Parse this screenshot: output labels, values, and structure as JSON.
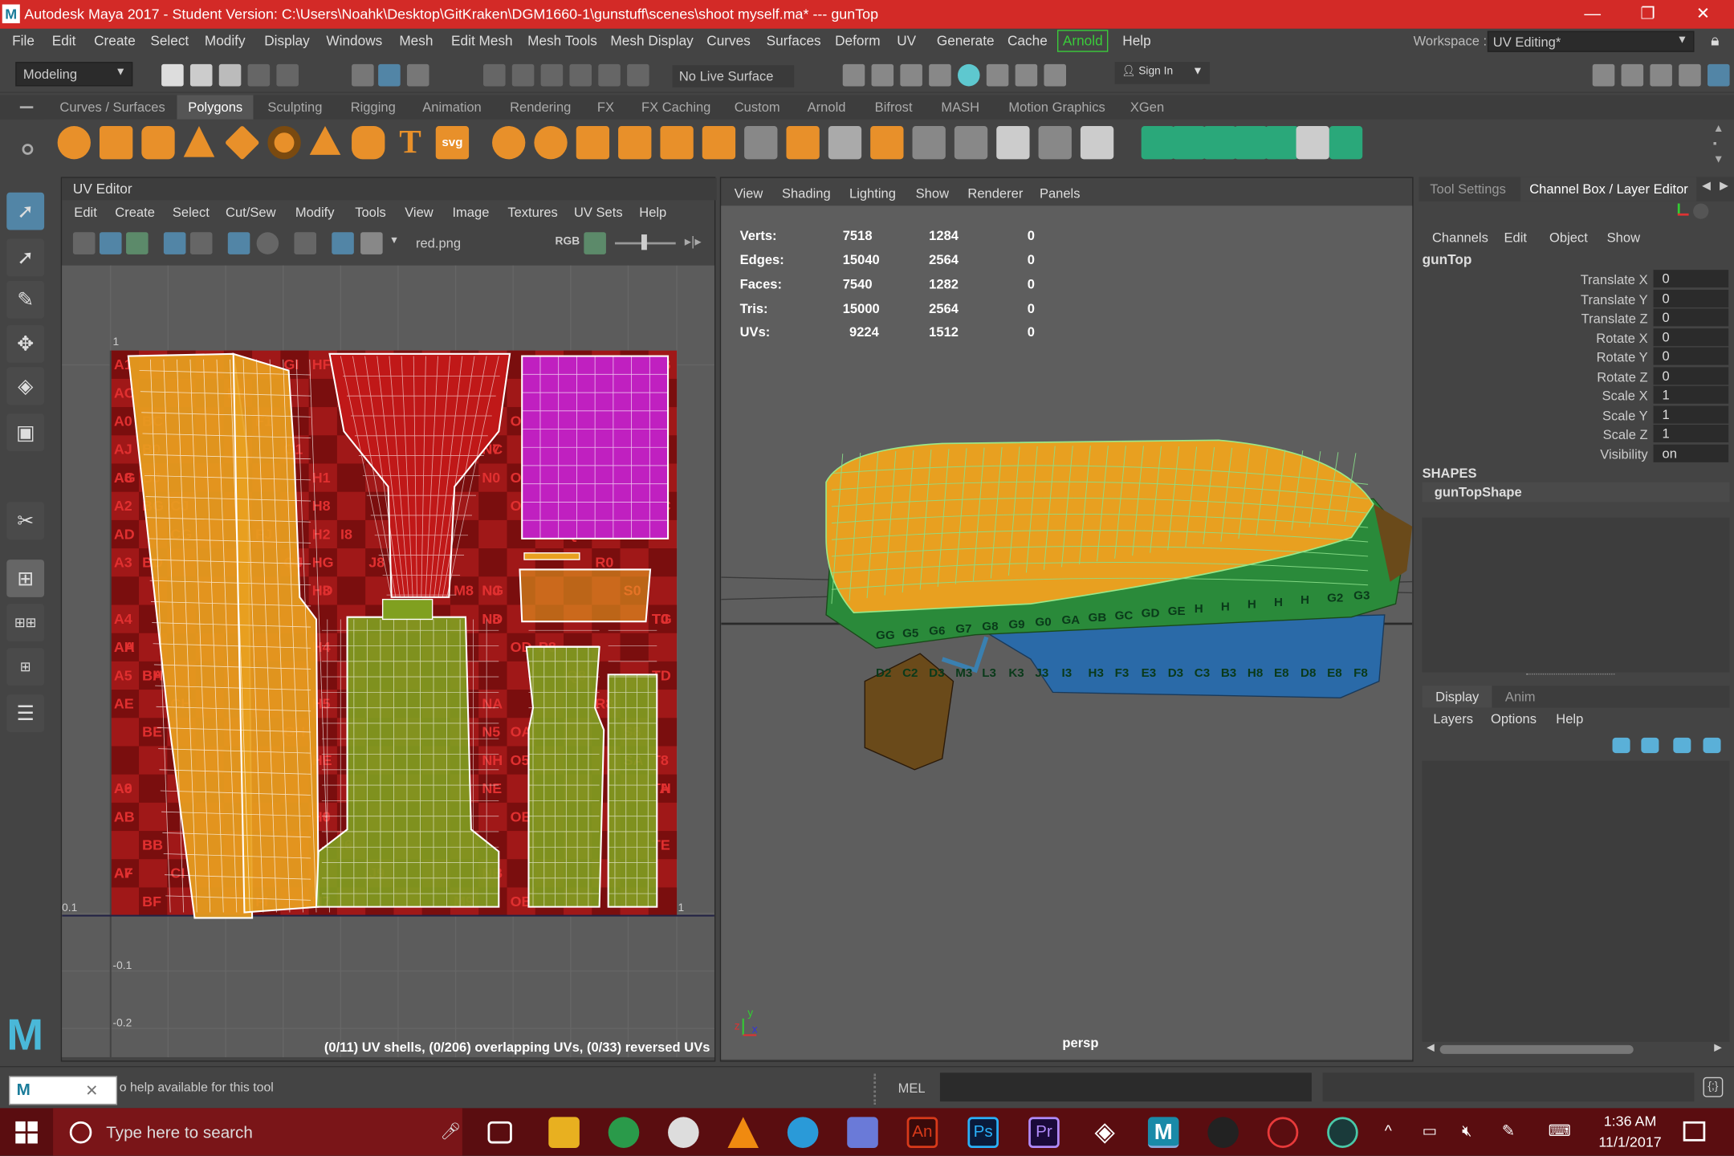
{
  "window": {
    "logo": "M",
    "title": "Autodesk Maya 2017 - Student Version: C:\\Users\\Noahk\\Desktop\\GitKraken\\DGM1660-1\\gunstuff\\scenes\\shoot myself.ma*   ---   gunTop",
    "minimize_icon": "—",
    "restore_icon": "❐",
    "close_icon": "✕"
  },
  "menubar": {
    "items": [
      "File",
      "Edit",
      "Create",
      "Select",
      "Modify",
      "Display",
      "Windows",
      "Mesh",
      "Edit Mesh",
      "Mesh Tools",
      "Mesh Display",
      "Curves",
      "Surfaces",
      "Deform",
      "UV",
      "Generate",
      "Cache",
      "Arnold",
      "Help"
    ],
    "workspace_label": "Workspace :",
    "workspace_value": "UV Editing*"
  },
  "statusline": {
    "mode": "Modeling",
    "live_surface": "No Live Surface",
    "sign_in": "Sign In"
  },
  "shelf": {
    "tabs": [
      "Curves / Surfaces",
      "Polygons",
      "Sculpting",
      "Rigging",
      "Animation",
      "Rendering",
      "FX",
      "FX Caching",
      "Custom",
      "Arnold",
      "Bifrost",
      "MASH",
      "Motion Graphics",
      "XGen"
    ],
    "active": "Polygons",
    "text_tool": "T",
    "svg_tool": "svg"
  },
  "uv_editor": {
    "title": "UV Editor",
    "menus": [
      "Edit",
      "Create",
      "Select",
      "Cut/Sew",
      "Modify",
      "Tools",
      "View",
      "Image",
      "Textures",
      "UV Sets",
      "Help"
    ],
    "image_name": "red.png",
    "rgb": "RGB",
    "axis_labels": {
      "top": "1",
      "left_mid": "0.1",
      "neg1": "-0.1",
      "neg2": "-0.2",
      "right_mid": "1"
    },
    "status": "(0/11) UV shells, (0/206) overlapping UVs, (0/33) reversed UVs",
    "checker_labels": [
      "A1",
      "E1",
      "F1",
      "G1",
      "H1",
      "A2",
      "H2",
      "A3",
      "H3",
      "A4",
      "H4",
      "A5",
      "H5",
      "N5",
      "O5",
      "A6",
      "H6",
      "I6",
      "A7",
      "H7",
      "I7",
      "J7",
      "M7",
      "N7",
      "A8",
      "H8",
      "I8",
      "J8",
      "M8",
      "N8",
      "P8",
      "Q8",
      "R8",
      "S8",
      "T8",
      "A9",
      "H9",
      "I9",
      "J9",
      "M9",
      "N9",
      "T9",
      "A0",
      "B0",
      "N0",
      "O0",
      "Q0",
      "R0",
      "S0",
      "T0",
      "AA",
      "BA",
      "NA",
      "OA",
      "SA",
      "TA",
      "AB",
      "BB",
      "NB",
      "OB",
      "TB",
      "AC",
      "BC",
      "NC",
      "OC",
      "TC",
      "AD",
      "BD",
      "HD",
      "ND",
      "OD",
      "TD",
      "AE",
      "BE",
      "HE",
      "NE",
      "OE",
      "TE",
      "AF",
      "BF",
      "HF",
      "NF",
      "OF",
      "TF",
      "AG",
      "BG",
      "CG",
      "HG",
      "NG",
      "TG",
      "AH",
      "BH",
      "CH",
      "GH",
      "NH",
      "TH",
      "AI",
      "BI",
      "CI",
      "FI",
      "GI",
      "NI",
      "TI",
      "AJ",
      "BJ",
      "CJ",
      "FJ",
      "GJ",
      "NJ",
      "TJ"
    ]
  },
  "viewport": {
    "menus": [
      "View",
      "Shading",
      "Lighting",
      "Show",
      "Renderer",
      "Panels"
    ],
    "hud": [
      {
        "label": "Verts:",
        "a": "7518",
        "b": "1284",
        "c": "0"
      },
      {
        "label": "Edges:",
        "a": "15040",
        "b": "2564",
        "c": "0"
      },
      {
        "label": "Faces:",
        "a": "7540",
        "b": "1282",
        "c": "0"
      },
      {
        "label": "Tris:",
        "a": "15000",
        "b": "2564",
        "c": "0"
      },
      {
        "label": "UVs:",
        "a": "9224",
        "b": "1512",
        "c": "0"
      }
    ],
    "camera": "persp",
    "axis_x": "x",
    "axis_y": "y",
    "axis_z": "z",
    "gun_labels": [
      "GG",
      "G5",
      "G6",
      "G7",
      "G8",
      "G9",
      "G0",
      "GA",
      "GB",
      "GC",
      "GD",
      "GE",
      "H",
      "H",
      "H",
      "H",
      "H",
      "G2",
      "G3",
      "D2",
      "C2",
      "D3",
      "M3",
      "L3",
      "K3",
      "J3",
      "I3",
      "H3",
      "F3",
      "E3",
      "D3",
      "C3",
      "B3",
      "H8",
      "E8",
      "D8",
      "E8",
      "F8"
    ]
  },
  "channel_box": {
    "tabs": [
      "Tool Settings",
      "Channel Box / Layer Editor"
    ],
    "menus": [
      "Channels",
      "Edit",
      "Object",
      "Show"
    ],
    "object": "gunTop",
    "attributes": [
      {
        "name": "Translate X",
        "value": "0"
      },
      {
        "name": "Translate Y",
        "value": "0"
      },
      {
        "name": "Translate Z",
        "value": "0"
      },
      {
        "name": "Rotate X",
        "value": "0"
      },
      {
        "name": "Rotate Y",
        "value": "0"
      },
      {
        "name": "Rotate Z",
        "value": "0"
      },
      {
        "name": "Scale X",
        "value": "1"
      },
      {
        "name": "Scale Y",
        "value": "1"
      },
      {
        "name": "Scale Z",
        "value": "1"
      },
      {
        "name": "Visibility",
        "value": "on"
      }
    ],
    "shapes_label": "SHAPES",
    "shape": "gunTopShape"
  },
  "layer_editor": {
    "tabs": [
      "Display",
      "Anim"
    ],
    "menus": [
      "Layers",
      "Options",
      "Help"
    ]
  },
  "command_line": {
    "help_text": "o help available for this tool",
    "mel": "MEL",
    "maya_icon": "M",
    "close": "✕"
  },
  "taskbar": {
    "search_placeholder": "Type here to search",
    "time": "1:36 AM",
    "date": "11/1/2017",
    "app_labels": {
      "an": "An",
      "ps": "Ps",
      "pr": "Pr",
      "maya": "M"
    }
  },
  "colors": {
    "title_red": "#d32a27",
    "accent_blue": "#5285a6",
    "uv_red": "#b01818",
    "uv_orange": "#e8a020",
    "uv_magenta": "#c020c0",
    "uv_green": "#80a020",
    "arnold_green": "#3acc3a"
  }
}
